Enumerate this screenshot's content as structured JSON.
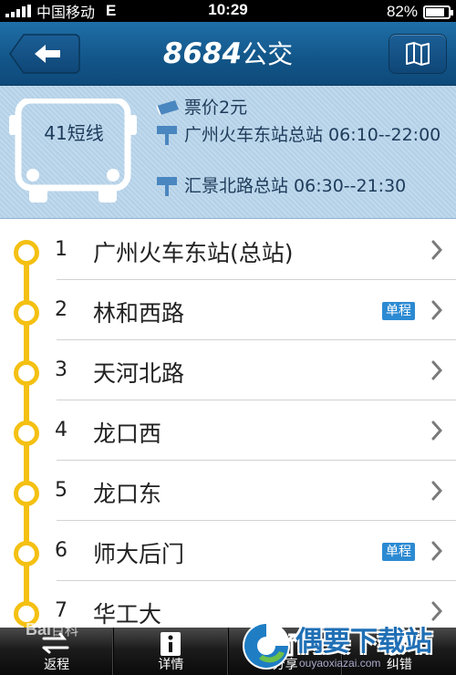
{
  "status_bar": {
    "carrier": "中国移动",
    "network": "E",
    "time": "10:29",
    "battery": "82%",
    "battery_level": 0.82
  },
  "nav": {
    "title_brand": "8684",
    "title_suffix": "公交",
    "back_icon": "arrow-left-icon",
    "map_icon": "map-icon"
  },
  "route": {
    "name": "41短线",
    "fare": "票价2元",
    "start_terminal": "广州火车东站总站 06:10--22:00",
    "end_terminal": "汇景北路总站 06:30--21:30"
  },
  "stops": [
    {
      "num": "1",
      "name": "广州火车东站(总站)",
      "badge": ""
    },
    {
      "num": "2",
      "name": "林和西路",
      "badge": "单程"
    },
    {
      "num": "3",
      "name": "天河北路",
      "badge": ""
    },
    {
      "num": "4",
      "name": "龙口西",
      "badge": ""
    },
    {
      "num": "5",
      "name": "龙口东",
      "badge": ""
    },
    {
      "num": "6",
      "name": "师大后门",
      "badge": "单程"
    },
    {
      "num": "7",
      "name": "华工大",
      "badge": ""
    }
  ],
  "tabs": [
    {
      "label": "返程",
      "icon": "swap-arrows-icon"
    },
    {
      "label": "详情",
      "icon": "info-icon"
    },
    {
      "label": "分享",
      "icon": "share-icon"
    },
    {
      "label": "纠错",
      "icon": "edit-icon"
    }
  ],
  "watermarks": {
    "baidu": "Bai",
    "baidu_suffix": "百科",
    "site": "偶要下载站",
    "site_url": "ouyaoxiazai.com"
  },
  "colors": {
    "nav_blue": "#125588",
    "panel_blue": "#b7d4eb",
    "rail_yellow": "#f4c012",
    "badge_blue": "#2c8ad2"
  }
}
